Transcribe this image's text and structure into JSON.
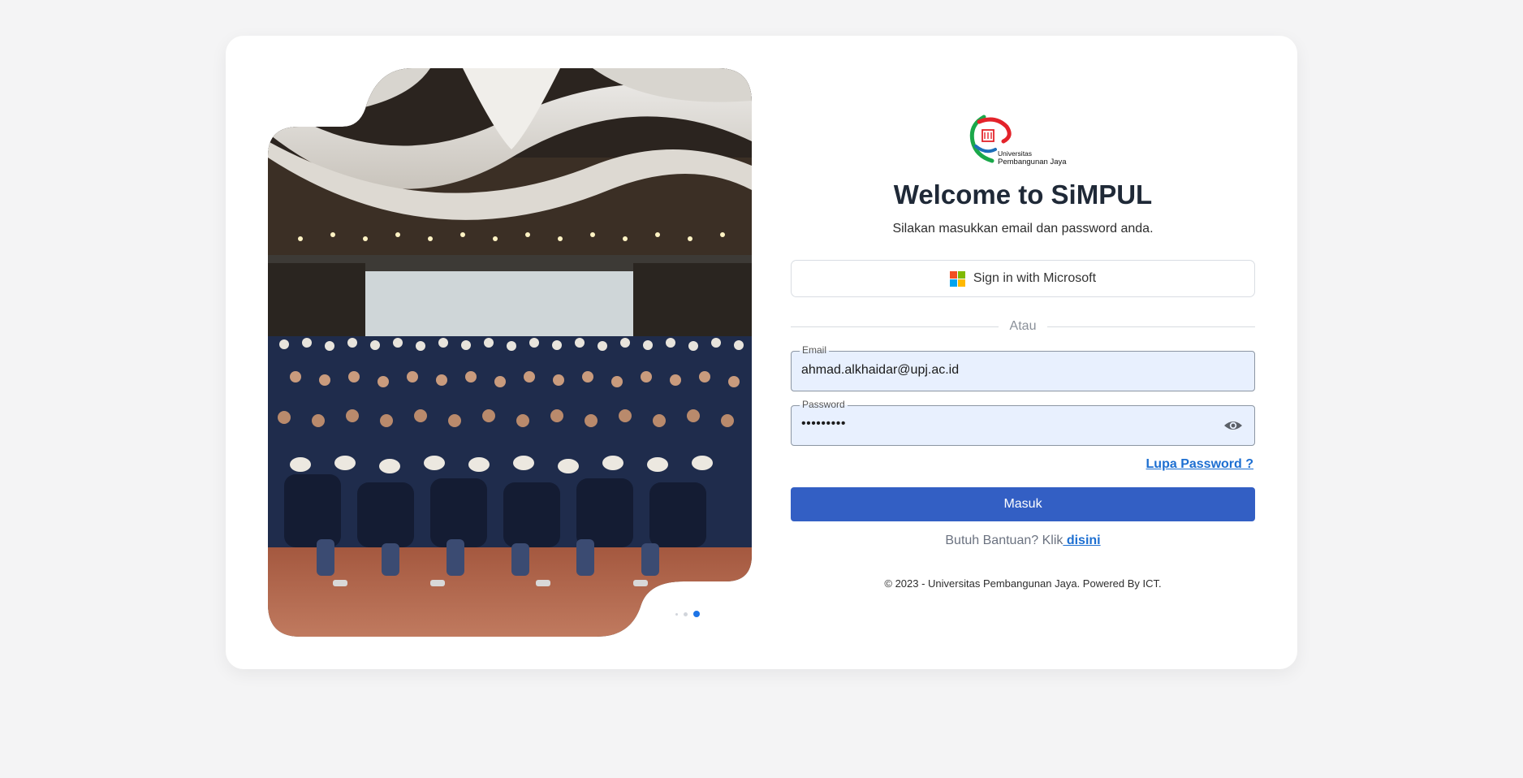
{
  "app": {
    "title": "Welcome to SiMPUL",
    "subtitle": "Silakan masukkan email dan password anda."
  },
  "logo": {
    "line1": "Universitas",
    "line2": "Pembangunan Jaya",
    "colors": {
      "green": "#1aa84a",
      "red": "#e3232a",
      "blue": "#1d6fb8"
    }
  },
  "microsoft_button": {
    "label": "Sign in with Microsoft",
    "icon": "microsoft-logo-icon",
    "colors": [
      "#f25022",
      "#7fba00",
      "#00a4ef",
      "#ffb900"
    ]
  },
  "divider": {
    "label": "Atau"
  },
  "form": {
    "email_label": "Email",
    "email_value": "ahmad.alkhaidar@upj.ac.id",
    "password_label": "Password",
    "password_masked": "•••••••••",
    "password_toggle_icon": "eye-icon",
    "forgot_label": "Lupa Password ?",
    "submit_label": "Masuk"
  },
  "help": {
    "prefix": "Butuh Bantuan? Klik",
    "link": " disini"
  },
  "footer": "© 2023 - Universitas Pembangunan Jaya. Powered By ICT.",
  "carousel": {
    "slide_count": 3,
    "active_index": 2,
    "image": "group-photo"
  },
  "theme": {
    "accent": "#335fc4",
    "link": "#1d6fd1",
    "field_bg": "#e8f0fe",
    "page_bg": "#f4f4f5"
  }
}
